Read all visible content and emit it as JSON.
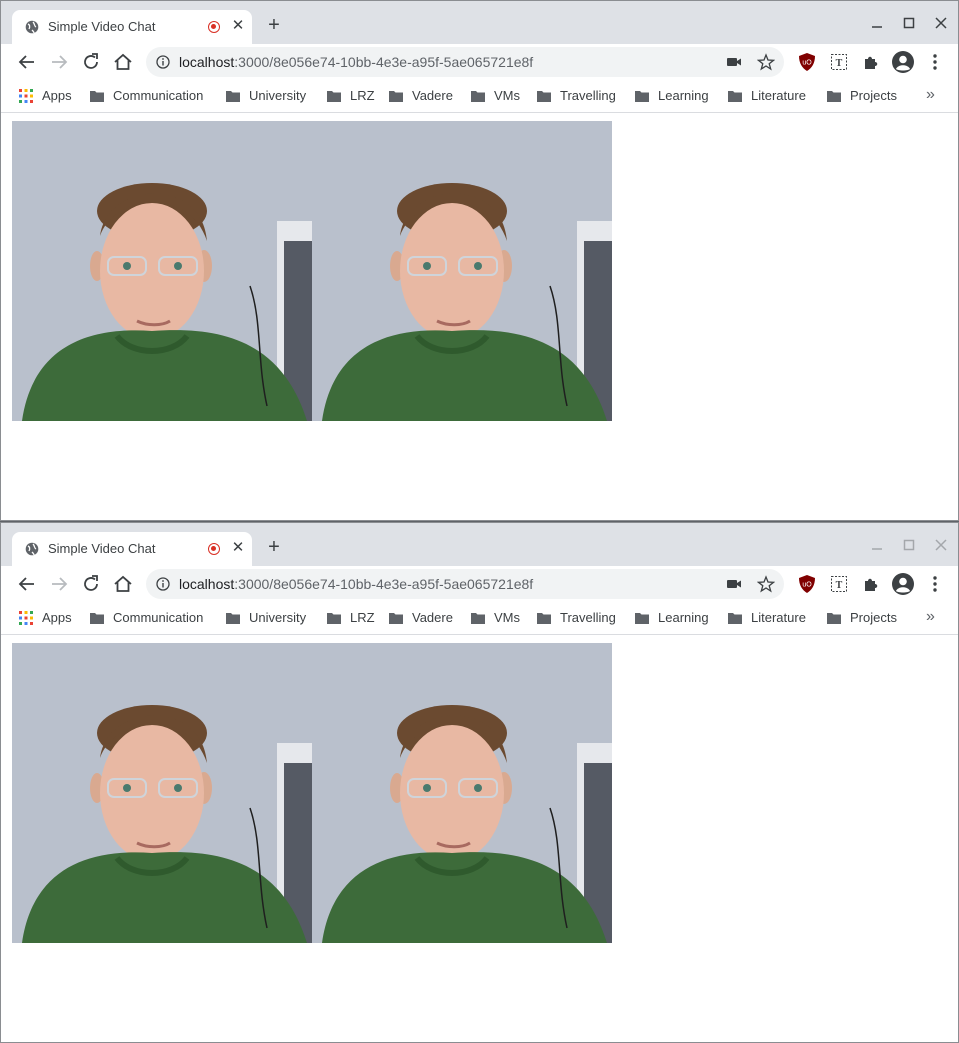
{
  "windows": [
    {
      "tab": {
        "title": "Simple Video Chat"
      },
      "address": {
        "host": "localhost",
        "path": ":3000/8e056e74-10bb-4e3e-a95f-5ae065721e8f"
      },
      "bookmarks": [
        {
          "label": "Apps",
          "icon": "apps-grid-icon"
        },
        {
          "label": "Communication",
          "icon": "folder-icon"
        },
        {
          "label": "University",
          "icon": "folder-icon"
        },
        {
          "label": "LRZ",
          "icon": "folder-icon"
        },
        {
          "label": "Vadere",
          "icon": "folder-icon"
        },
        {
          "label": "VMs",
          "icon": "folder-icon"
        },
        {
          "label": "Travelling",
          "icon": "folder-icon"
        },
        {
          "label": "Learning",
          "icon": "folder-icon"
        },
        {
          "label": "Literature",
          "icon": "folder-icon"
        },
        {
          "label": "Projects",
          "icon": "folder-icon"
        }
      ],
      "bookmarks_overflow": "»",
      "videos": [
        {
          "name": "local-video"
        },
        {
          "name": "remote-video"
        }
      ],
      "focused": true
    },
    {
      "tab": {
        "title": "Simple Video Chat"
      },
      "address": {
        "host": "localhost",
        "path": ":3000/8e056e74-10bb-4e3e-a95f-5ae065721e8f"
      },
      "bookmarks": [
        {
          "label": "Apps",
          "icon": "apps-grid-icon"
        },
        {
          "label": "Communication",
          "icon": "folder-icon"
        },
        {
          "label": "University",
          "icon": "folder-icon"
        },
        {
          "label": "LRZ",
          "icon": "folder-icon"
        },
        {
          "label": "Vadere",
          "icon": "folder-icon"
        },
        {
          "label": "VMs",
          "icon": "folder-icon"
        },
        {
          "label": "Travelling",
          "icon": "folder-icon"
        },
        {
          "label": "Learning",
          "icon": "folder-icon"
        },
        {
          "label": "Literature",
          "icon": "folder-icon"
        },
        {
          "label": "Projects",
          "icon": "folder-icon"
        }
      ],
      "bookmarks_overflow": "»",
      "videos": [
        {
          "name": "local-video"
        },
        {
          "name": "remote-video"
        }
      ],
      "focused": false
    }
  ],
  "colors": {
    "titlebar": "#dee1e6",
    "omnibox": "#f1f3f4",
    "recording": "#d93025",
    "ublock": "#800000",
    "sweater": "#3d6b3a",
    "wall": "#b9c0cc"
  }
}
